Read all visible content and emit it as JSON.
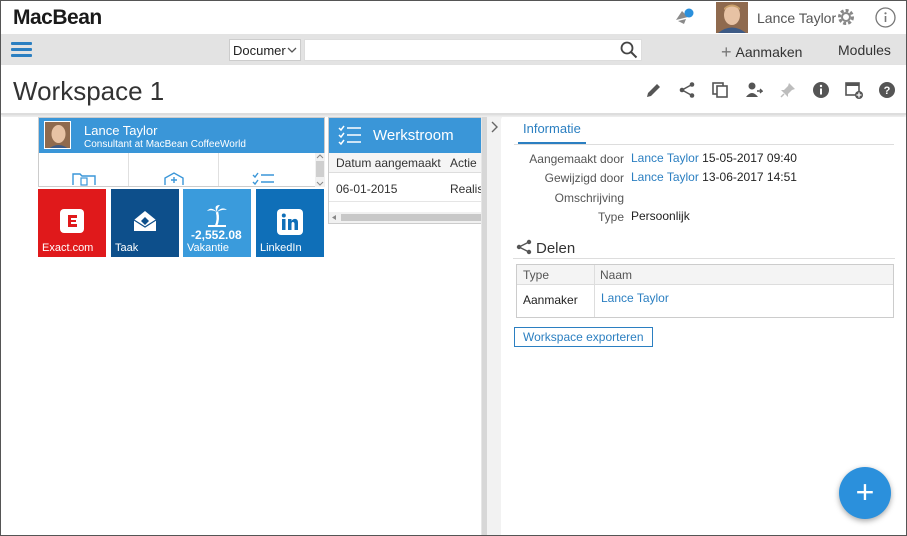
{
  "app": {
    "logo": "MacBean"
  },
  "user": {
    "name": "Lance Taylor"
  },
  "toolbar": {
    "search_scope": "Documer",
    "search_placeholder": "",
    "create_label": "Aanmaken",
    "modules_label": "Modules"
  },
  "workspace": {
    "title": "Workspace 1"
  },
  "profile_card": {
    "name": "Lance Taylor",
    "subtitle": "Consultant at MacBean CoffeeWorld"
  },
  "tiles": [
    {
      "label": "Exact.com",
      "color": "#e0191b"
    },
    {
      "label": "Taak",
      "color": "#0d4f8b"
    },
    {
      "label": "Vakantie",
      "value": "-2,552.08",
      "color": "#3a9bdc"
    },
    {
      "label": "LinkedIn",
      "color": "#0f6fb8"
    }
  ],
  "workflow": {
    "title": "Werkstroom",
    "columns": [
      "Datum aangemaakt",
      "Actie"
    ],
    "rows": [
      {
        "date": "06-01-2015",
        "action": "Realise"
      }
    ]
  },
  "info": {
    "tab": "Informatie",
    "created_by_label": "Aangemaakt door",
    "created_by_user": "Lance Taylor",
    "created_at": "15-05-2017 09:40",
    "modified_by_label": "Gewijzigd door",
    "modified_by_user": "Lance Taylor",
    "modified_at": "13-06-2017 14:51",
    "description_label": "Omschrijving",
    "description": "",
    "type_label": "Type",
    "type": "Persoonlijk"
  },
  "share": {
    "title": "Delen",
    "columns": [
      "Type",
      "Naam"
    ],
    "rows": [
      {
        "type": "Aanmaker",
        "name": "Lance Taylor"
      }
    ],
    "export_label": "Workspace exporteren"
  },
  "colors": {
    "accent": "#2b7fc1",
    "header_blue": "#3a96d8"
  }
}
